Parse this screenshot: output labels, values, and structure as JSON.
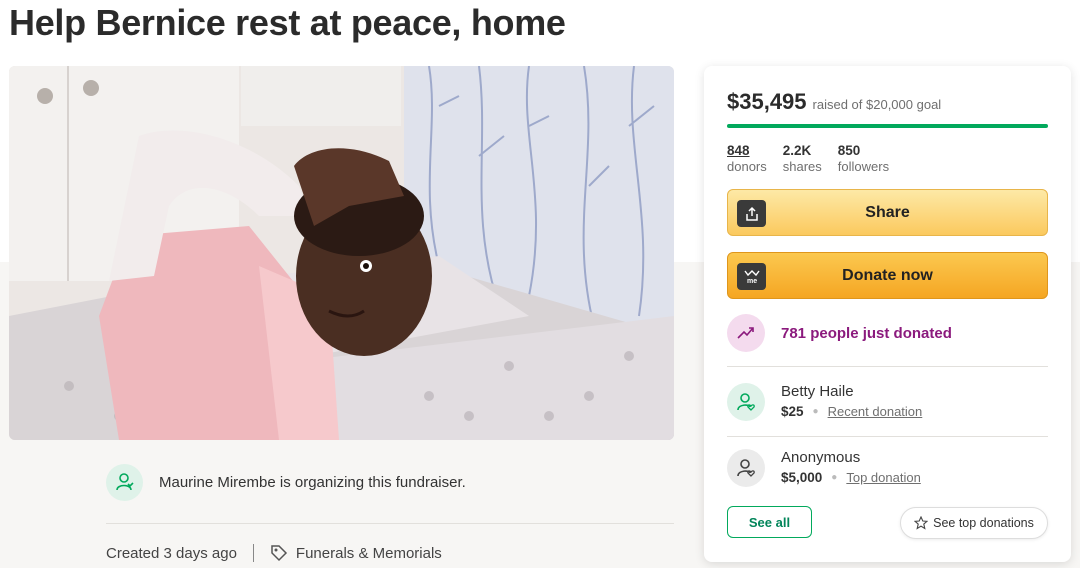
{
  "page": {
    "title": "Help Bernice rest at peace, home"
  },
  "hero": {
    "image_name": "fundraiser-photo"
  },
  "organizer": {
    "text": "Maurine Mirembe is organizing this fundraiser."
  },
  "meta": {
    "created": "Created 3 days ago",
    "category": "Funerals & Memorials"
  },
  "donation_card": {
    "raised_amount": "$35,495",
    "goal_text": "raised of $20,000 goal",
    "progress_fraction": 1.0,
    "stats": [
      {
        "num": "848",
        "label": "donors"
      },
      {
        "num": "2.2K",
        "label": "shares"
      },
      {
        "num": "850",
        "label": "followers"
      }
    ],
    "share_label": "Share",
    "donate_label": "Donate now",
    "just_donated": "781 people just donated",
    "donors": [
      {
        "name": "Betty Haile",
        "amount": "$25",
        "kind": "Recent donation"
      },
      {
        "name": "Anonymous",
        "amount": "$5,000",
        "kind": "Top donation"
      }
    ],
    "see_all_label": "See all",
    "see_top_label": "See top donations"
  },
  "colors": {
    "accent_green": "#02a95c",
    "donate_orange": "#f5a623",
    "share_yellow": "#fbc95e",
    "trend_purple": "#8b1a7d"
  }
}
